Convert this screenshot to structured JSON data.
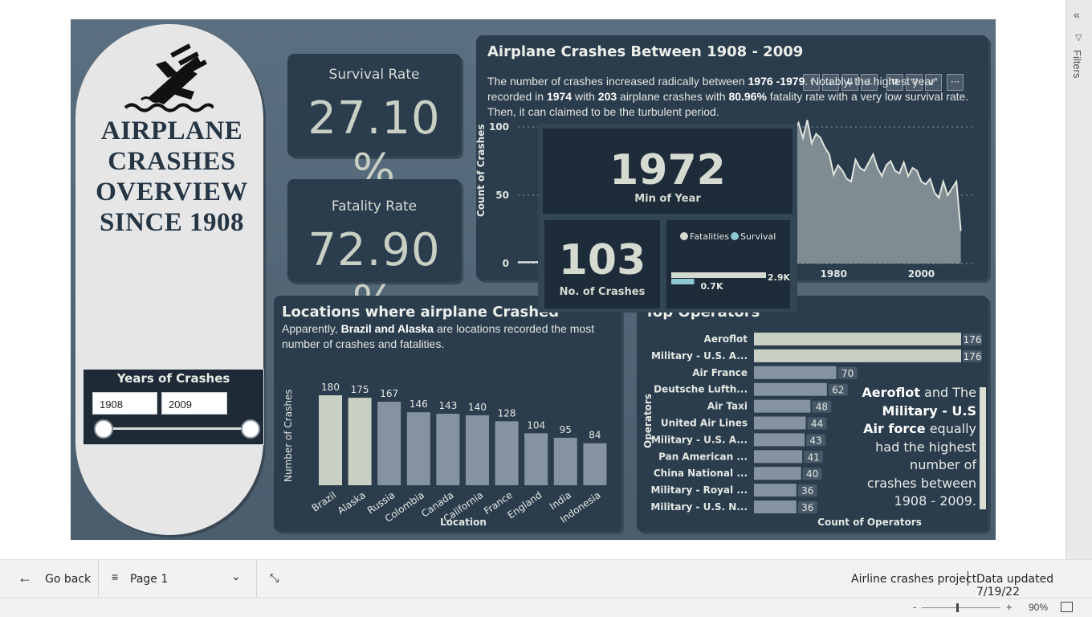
{
  "title": {
    "line1": "AIRPLANE",
    "line2": "CRASHES",
    "line3": "OVERVIEW",
    "line4": "SINCE 1908"
  },
  "years_slicer": {
    "title": "Years of Crashes",
    "from": "1908",
    "to": "2009"
  },
  "kpis": {
    "survival": {
      "label": "Survival Rate",
      "value": "27.10 %"
    },
    "fatality": {
      "label": "Fatality Rate",
      "value": "72.90 %"
    }
  },
  "timeline": {
    "title": "Airplane Crashes Between 1908 - 2009",
    "desc": {
      "p1": "The number of crashes increased radically  between ",
      "b1": "1976 -1979",
      "p2": ". Notably, the highest year",
      "p3": "recorded in ",
      "b2": "1974",
      "p4": " with ",
      "b3": "203",
      "p5": " airplane crashes with ",
      "b4": "80.96%",
      "p6": " fatality rate with a very low survival rate.",
      "p7": "Then, it can claimed to be the turbulent  period."
    }
  },
  "locations": {
    "title": "Locations where airplane Crashed",
    "desc": {
      "p1": "Apparently, ",
      "b1": "Brazil and Alaska",
      "p2": " are locations recorded the most",
      "p3": "number of crashes and fatalities."
    }
  },
  "operators": {
    "title": "Top Operators",
    "note": {
      "b1": "Aeroflot",
      "p1": " and The ",
      "b2": "Military - U.S Air force",
      "p2": " equally had the highest number of crashes between 1908 - 2009."
    }
  },
  "tooltip": {
    "year": "1972",
    "year_label": "Min of Year",
    "crashes": "103",
    "crashes_label": "No. of Crashes",
    "legend": [
      "Fatalities",
      "Survival"
    ],
    "bar1_label": "2.9K",
    "bar2_label": "0.7K",
    "fatalities": 2900,
    "survival": 700
  },
  "chart_data": [
    {
      "type": "area",
      "xlabel": "",
      "ylabel": "Count of Crashes",
      "ylim": [
        0,
        100
      ],
      "yticks": [
        "0",
        "50",
        "100"
      ],
      "xticks": [
        "1980",
        "2000"
      ],
      "x": [
        1908,
        1912,
        1916,
        1920,
        1924,
        1928,
        1932,
        1936,
        1940,
        1944,
        1948,
        1952,
        1956,
        1960,
        1964,
        1968,
        1972,
        1973,
        1974,
        1975,
        1976,
        1977,
        1978,
        1979,
        1980,
        1981,
        1982,
        1983,
        1984,
        1985,
        1986,
        1987,
        1988,
        1989,
        1990,
        1991,
        1992,
        1993,
        1994,
        1995,
        1996,
        1997,
        1998,
        1999,
        2000,
        2001,
        2002,
        2003,
        2004,
        2005,
        2006,
        2007,
        2008,
        2009
      ],
      "y": [
        1,
        1,
        2,
        5,
        8,
        15,
        25,
        40,
        55,
        70,
        60,
        65,
        62,
        70,
        75,
        80,
        103,
        92,
        203,
        88,
        95,
        92,
        85,
        80,
        65,
        72,
        68,
        62,
        60,
        76,
        70,
        68,
        74,
        80,
        70,
        64,
        72,
        75,
        68,
        66,
        74,
        64,
        70,
        68,
        60,
        58,
        62,
        52,
        48,
        60,
        50,
        55,
        60,
        24
      ]
    },
    {
      "type": "bar",
      "xlabel": "Location",
      "ylabel": "Number of Crashes",
      "categories": [
        "Brazil",
        "Alaska",
        "Russia",
        "Colombia",
        "Canada",
        "California",
        "France",
        "England",
        "India",
        "Indonesia"
      ],
      "values": [
        180,
        175,
        167,
        146,
        143,
        140,
        128,
        104,
        95,
        84
      ]
    },
    {
      "type": "bar",
      "orientation": "horizontal",
      "xlabel": "Count of Operators",
      "ylabel": "Operators",
      "categories": [
        "Aeroflot",
        "Military - U.S. A...",
        "Air France",
        "Deutsche Lufth...",
        "Air Taxi",
        "United Air Lines",
        "Military - U.S. A...",
        "Pan American ...",
        "China National ...",
        "Military - Royal ...",
        "Military - U.S. N..."
      ],
      "values": [
        176,
        176,
        70,
        62,
        48,
        44,
        43,
        41,
        40,
        36,
        36
      ]
    }
  ],
  "filters_pane": {
    "label": "Filters"
  },
  "bottom_bar": {
    "back": "Go back",
    "page": "Page 1",
    "project": "Airline crashes project",
    "updated": "Data updated 7/19/22",
    "zoom": "90%"
  }
}
